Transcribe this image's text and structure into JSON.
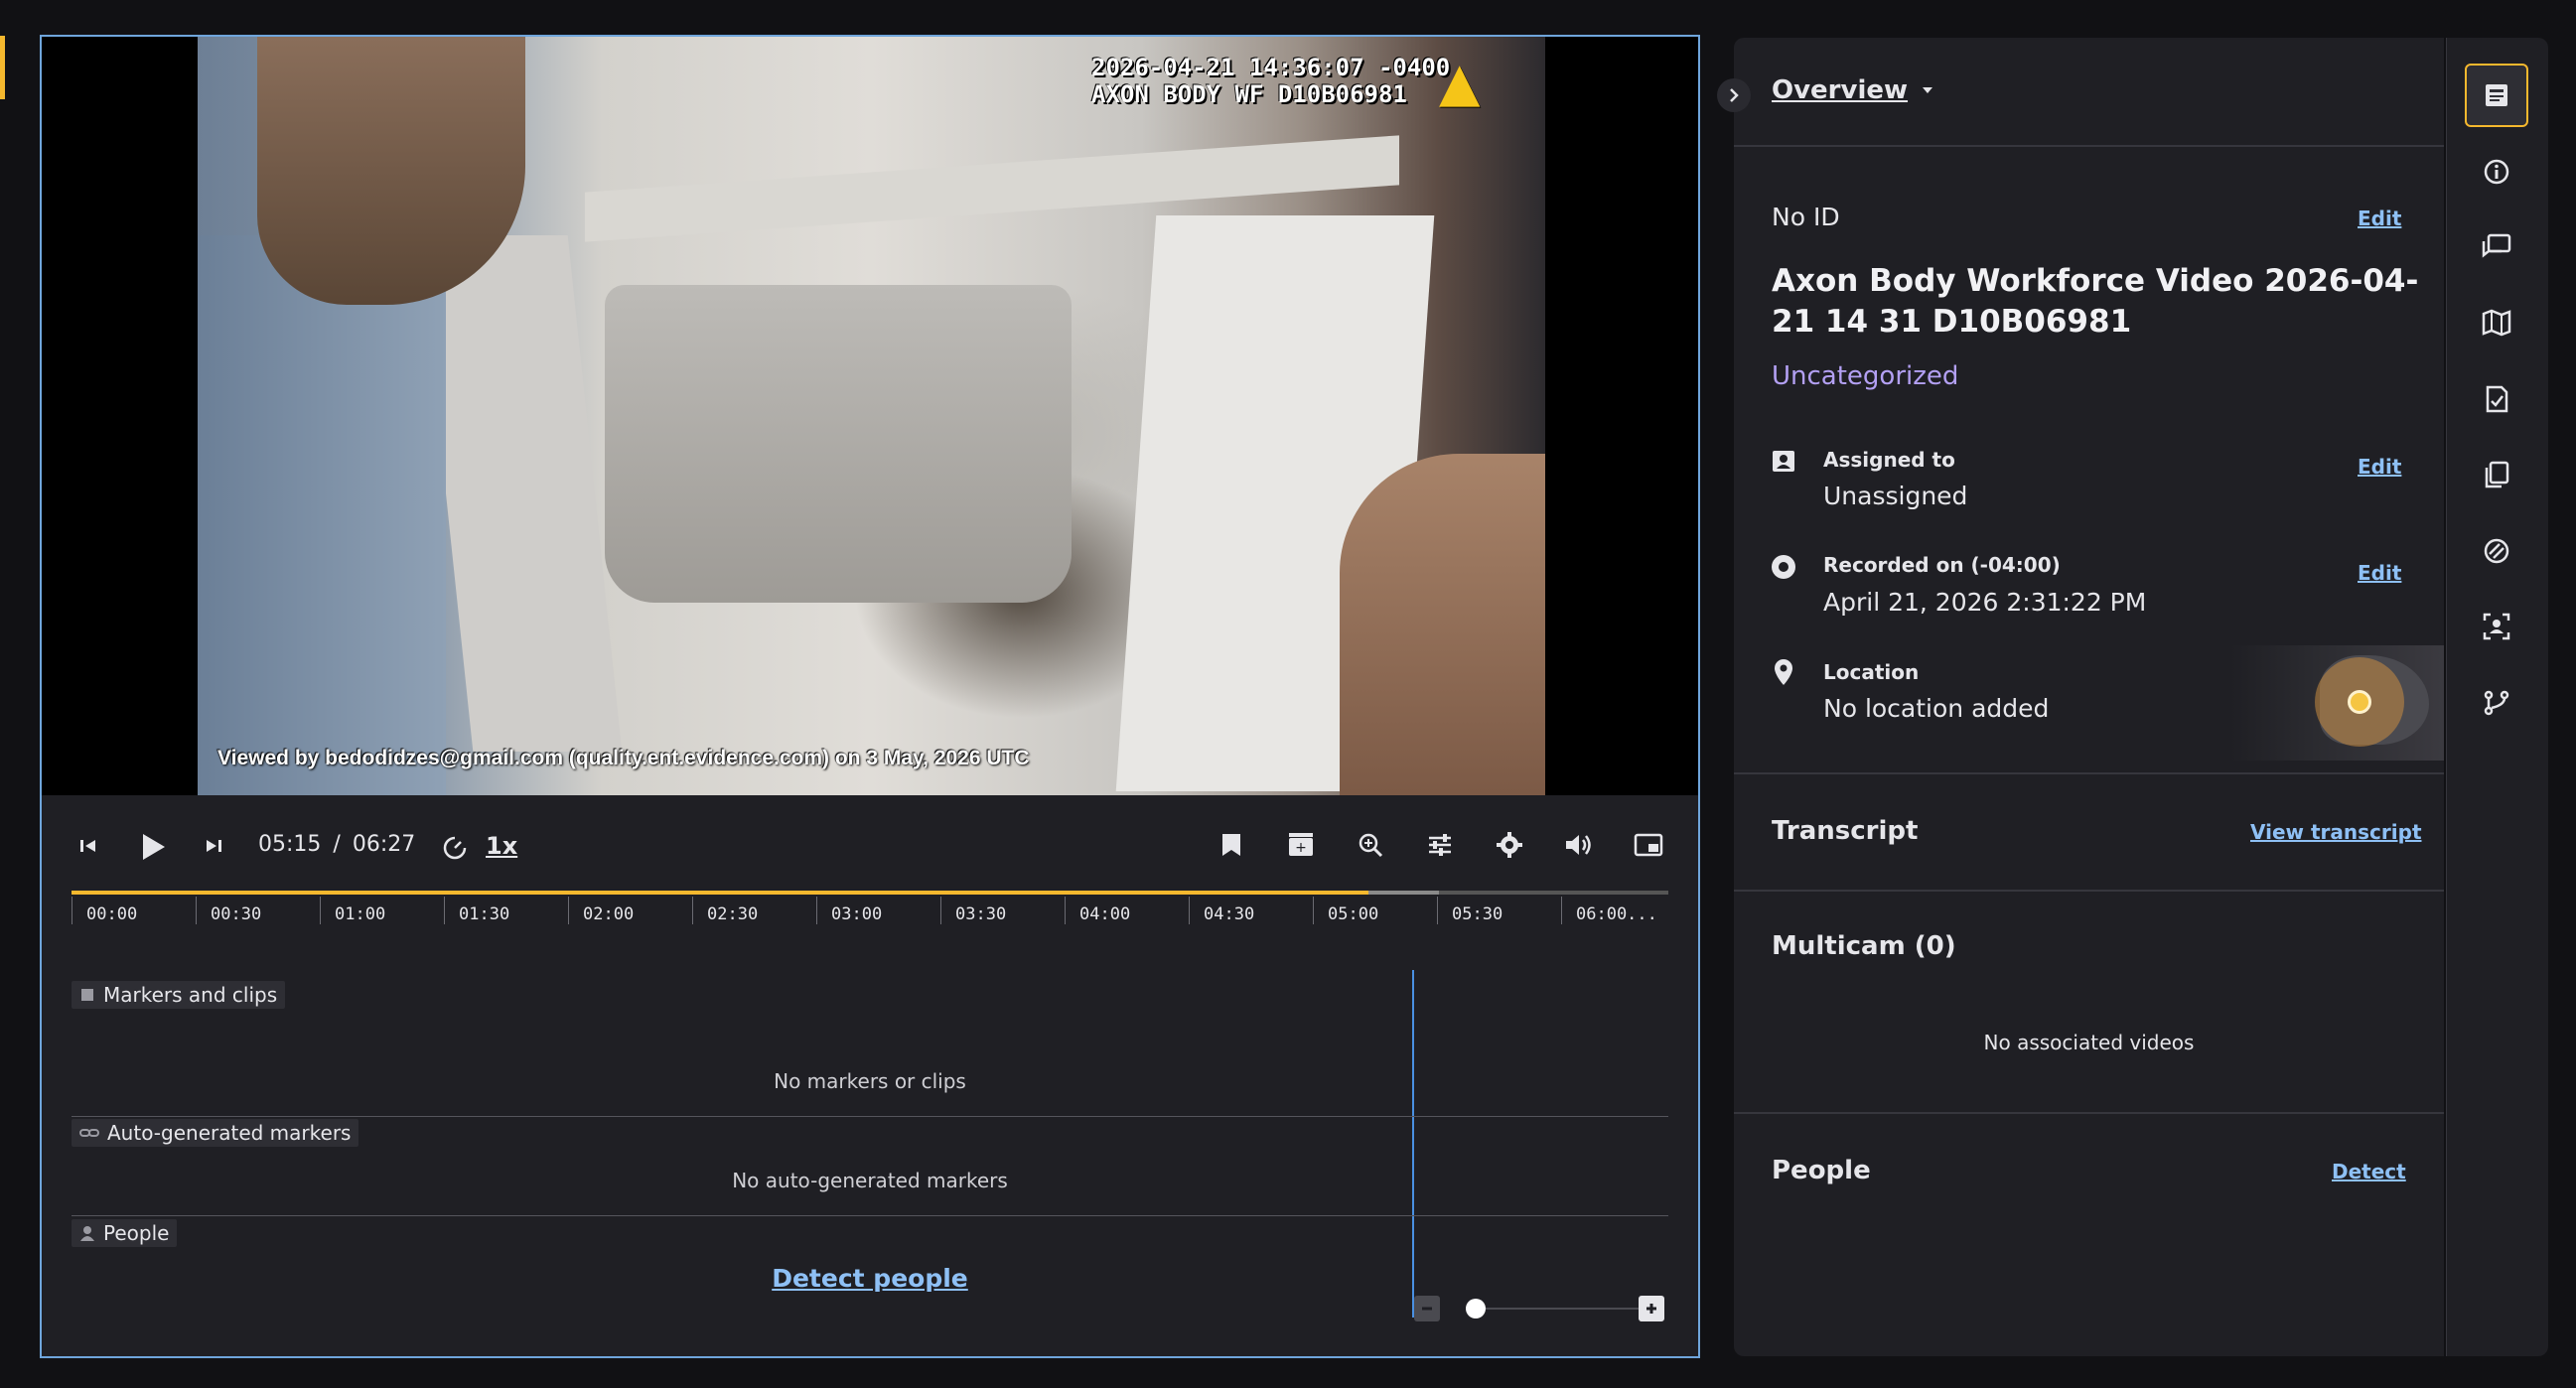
{
  "video": {
    "osd_line1": "2026-04-21 14:36:07 -0400",
    "osd_line2": "AXON BODY WF D10B06981",
    "watermark": "Viewed by bedodidzes@gmail.com (quality.ent.evidence.com) on 3 May, 2026 UTC"
  },
  "controls": {
    "current_time": "05:15",
    "separator": "/",
    "duration": "06:27",
    "speed": "1x",
    "progress_fraction": 0.812
  },
  "timeline": {
    "ticks": [
      "00:00",
      "00:30",
      "01:00",
      "01:30",
      "02:00",
      "02:30",
      "03:00",
      "03:30",
      "04:00",
      "04:30",
      "05:00",
      "05:30",
      "06:00..."
    ],
    "tracks": [
      {
        "label": "Markers and clips",
        "empty": "No markers or clips"
      },
      {
        "label": "Auto-generated markers",
        "empty": "No auto-generated markers"
      },
      {
        "label": "People",
        "action": "Detect people"
      }
    ]
  },
  "panel": {
    "header": "Overview",
    "id_label": "No ID",
    "edit_label": "Edit",
    "title": "Axon Body Workforce Video 2026-04-21 14 31 D10B06981",
    "category": "Uncategorized",
    "assigned_label": "Assigned to",
    "assigned_value": "Unassigned",
    "recorded_label": "Recorded on (-04:00)",
    "recorded_value": "April 21, 2026 2:31:22 PM",
    "location_label": "Location",
    "location_value": "No location added",
    "transcript_label": "Transcript",
    "view_transcript": "View transcript",
    "multicam_label": "Multicam (0)",
    "multicam_empty": "No associated videos",
    "people_label": "People",
    "detect_label": "Detect"
  },
  "colors": {
    "accent": "#f5b82e",
    "link": "#8ec0f5",
    "category": "#b3a0f3",
    "playhead": "#4a90e2"
  },
  "rail_icons": [
    "overview-icon",
    "info-icon",
    "comments-icon",
    "map-icon",
    "audit-icon",
    "copies-icon",
    "redaction-icon",
    "face-detect-icon",
    "branch-icon"
  ]
}
